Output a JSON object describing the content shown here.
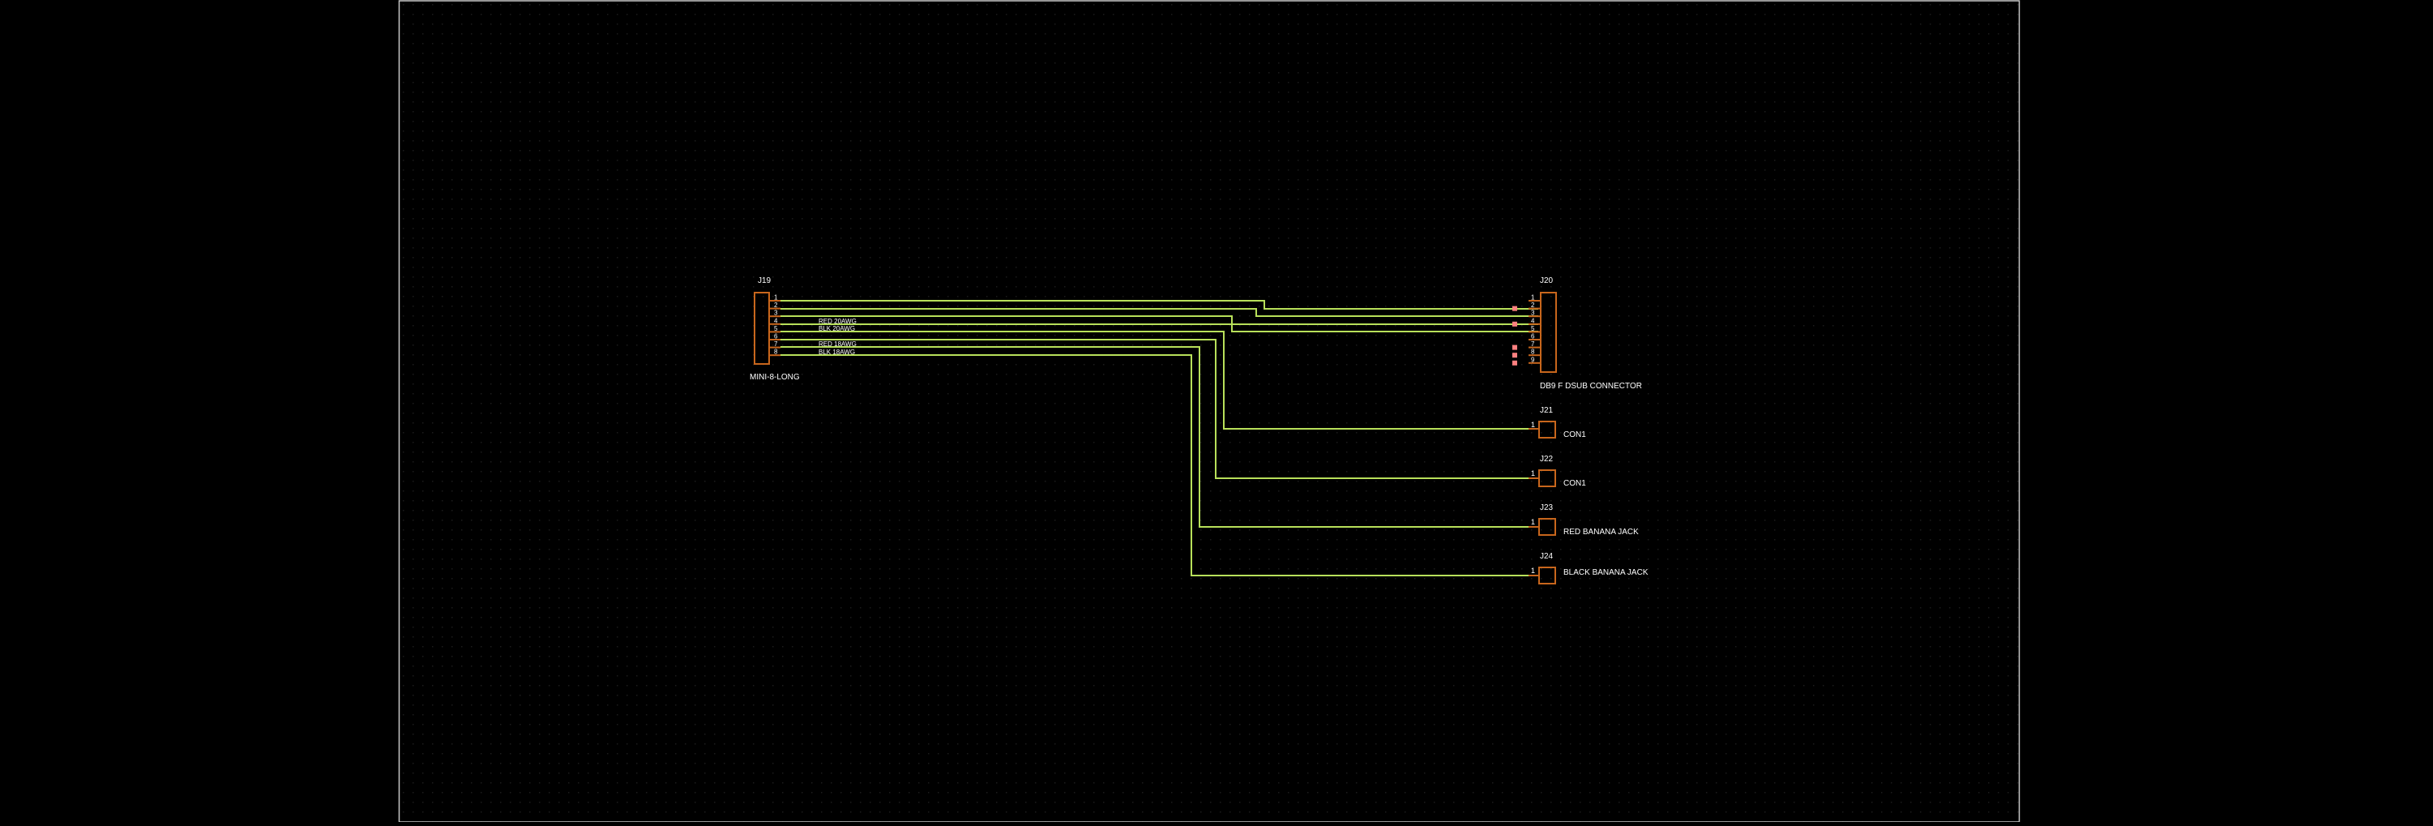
{
  "colors": {
    "background": "#000000",
    "grid_dot": "#1c1c1c",
    "sheet_border": "#c8c8c8",
    "wire": "#b8e05a",
    "component": "#c8661c",
    "pin_text": "#ffffff",
    "label_text": "#ffffff",
    "nc_marker": "#ff8080"
  },
  "components": {
    "j19": {
      "ref": "J19",
      "value": "MINI-8-LONG",
      "pins": [
        "1",
        "2",
        "3",
        "4",
        "5",
        "6",
        "7",
        "8"
      ]
    },
    "j20": {
      "ref": "J20",
      "value": "DB9 F DSUB CONNECTOR",
      "pins": [
        "1",
        "2",
        "3",
        "4",
        "5",
        "6",
        "7",
        "8",
        "9"
      ]
    },
    "j21": {
      "ref": "J21",
      "value": "CON1",
      "pin": "1"
    },
    "j22": {
      "ref": "J22",
      "value": "CON1",
      "pin": "1"
    },
    "j23": {
      "ref": "J23",
      "value": "RED BANANA JACK",
      "pin": "1"
    },
    "j24": {
      "ref": "J24",
      "value": "BLACK BANANA JACK",
      "pin": "1"
    }
  },
  "wire_labels": {
    "w4": "RED 20AWG",
    "w5": "BLK 20AWG",
    "w7": "RED 18AWG",
    "w8": "BLK 18AWG"
  }
}
